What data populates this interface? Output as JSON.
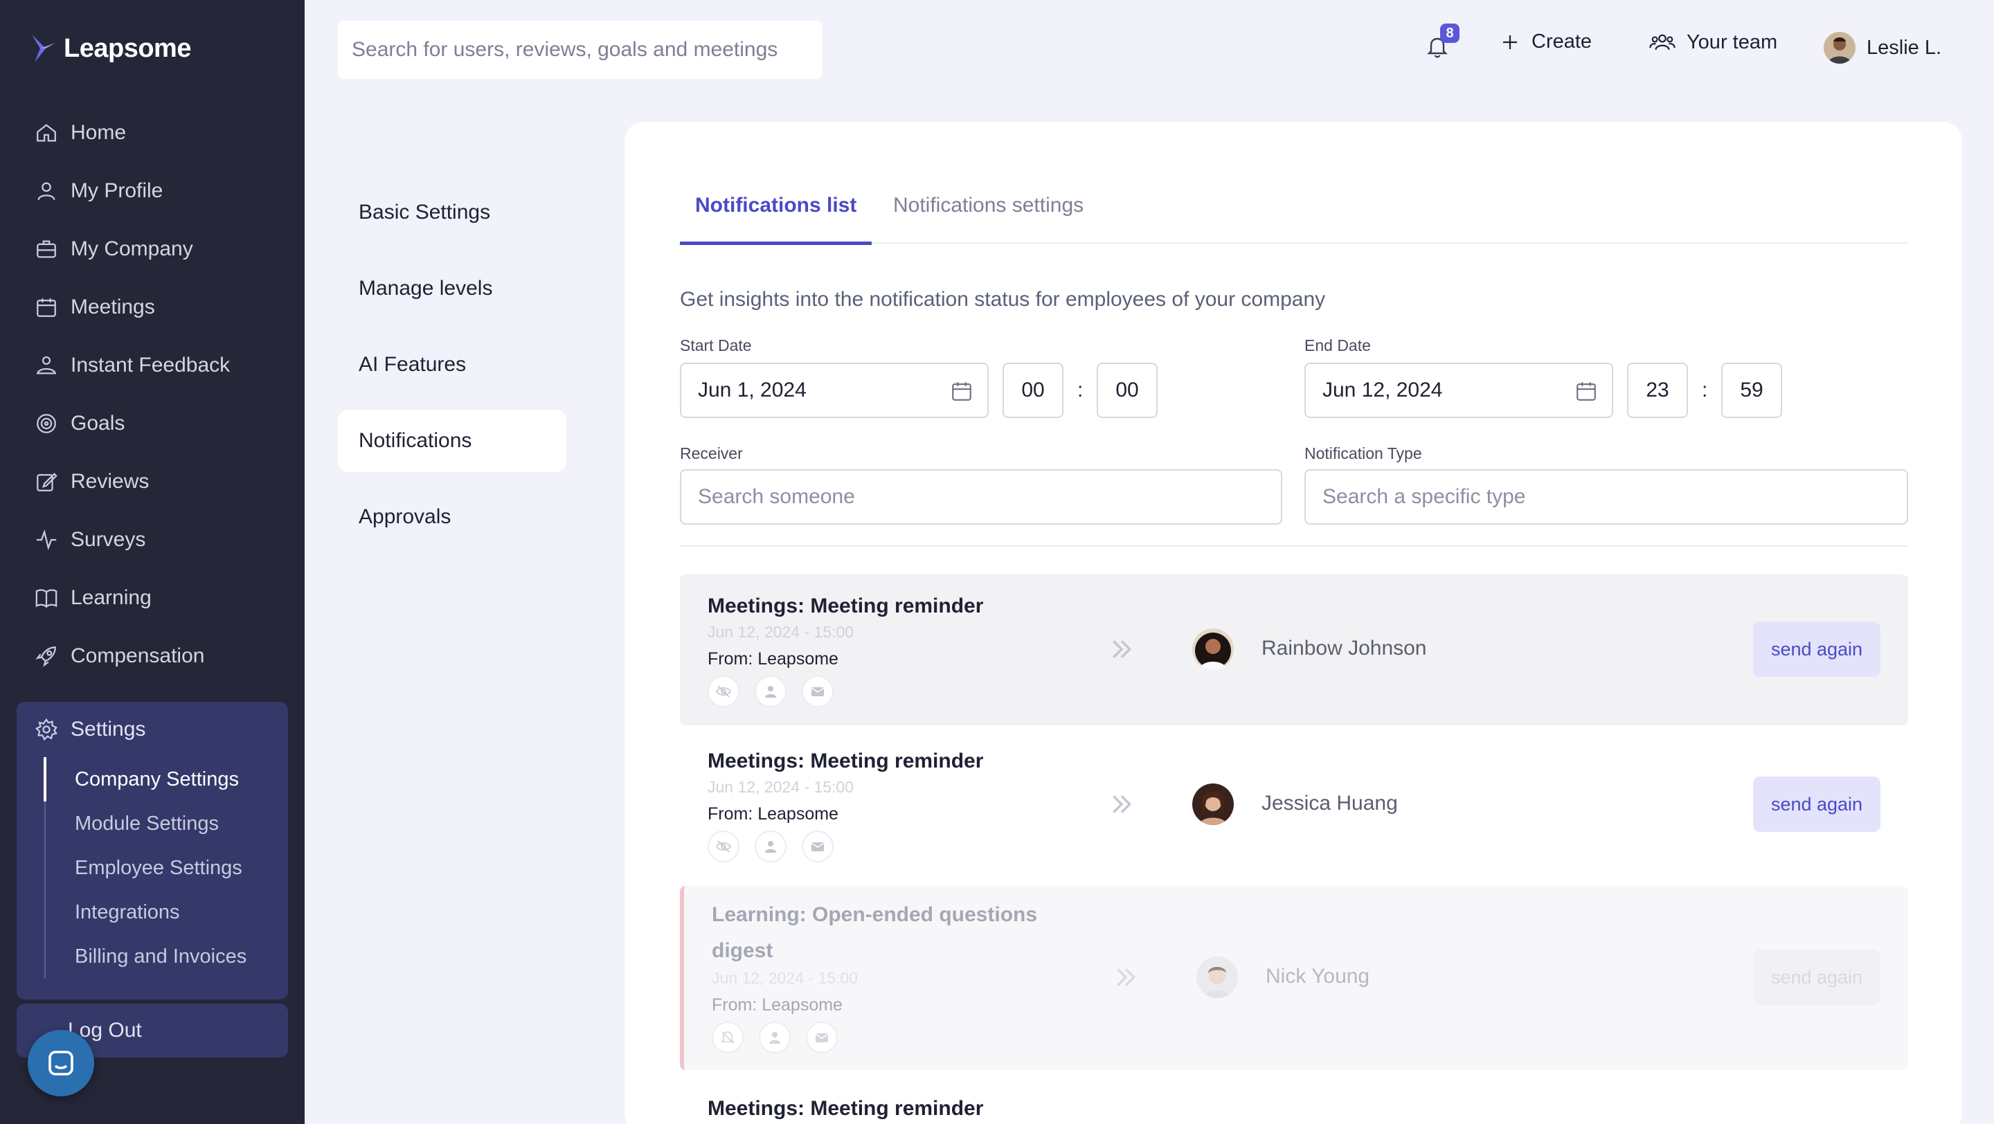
{
  "app": {
    "name": "Leapsome"
  },
  "sidebar": {
    "items": [
      {
        "label": "Home",
        "icon": "home-icon"
      },
      {
        "label": "My Profile",
        "icon": "user-icon"
      },
      {
        "label": "My Company",
        "icon": "briefcase-icon"
      },
      {
        "label": "Meetings",
        "icon": "calendar-icon"
      },
      {
        "label": "Instant Feedback",
        "icon": "feedback-icon"
      },
      {
        "label": "Goals",
        "icon": "target-icon"
      },
      {
        "label": "Reviews",
        "icon": "edit-icon"
      },
      {
        "label": "Surveys",
        "icon": "pulse-icon"
      },
      {
        "label": "Learning",
        "icon": "book-icon"
      },
      {
        "label": "Compensation",
        "icon": "rocket-icon"
      }
    ],
    "settings": {
      "label": "Settings",
      "subitems": [
        "Company Settings",
        "Module Settings",
        "Employee Settings",
        "Integrations",
        "Billing and Invoices"
      ],
      "active": "Company Settings"
    },
    "logout": "Log Out"
  },
  "header": {
    "search_placeholder": "Search for users, reviews, goals and meetings",
    "notification_count": "8",
    "create_label": "Create",
    "team_label": "Your team",
    "user_name": "Leslie L."
  },
  "settings_menu": {
    "items": [
      "Basic Settings",
      "Manage levels",
      "AI Features",
      "Notifications",
      "Approvals"
    ],
    "active": "Notifications"
  },
  "main": {
    "tabs": [
      {
        "label": "Notifications list",
        "active": true
      },
      {
        "label": "Notifications settings",
        "active": false
      }
    ],
    "description": "Get insights into the notification status for employees of your company",
    "filters": {
      "start_label": "Start Date",
      "start_date": "Jun 1, 2024",
      "start_hour": "00",
      "start_minute": "00",
      "end_label": "End Date",
      "end_date": "Jun 12, 2024",
      "end_hour": "23",
      "end_minute": "59",
      "receiver_label": "Receiver",
      "receiver_placeholder": "Search someone",
      "type_label": "Notification Type",
      "type_placeholder": "Search a specific type",
      "time_separator": ":"
    },
    "notifications": [
      {
        "title": "Meetings: Meeting reminder",
        "date": "Jun 12, 2024 - 15:00",
        "from": "From: Leapsome",
        "receiver": "Rainbow Johnson",
        "action": "send again",
        "state": "highlighted"
      },
      {
        "title": "Meetings: Meeting reminder",
        "date": "Jun 12, 2024 - 15:00",
        "from": "From: Leapsome",
        "receiver": "Jessica Huang",
        "action": "send again",
        "state": "normal"
      },
      {
        "title": "Learning: Open-ended questions digest",
        "date": "Jun 12, 2024 - 15:00",
        "from": "From: Leapsome",
        "receiver": "Nick Young",
        "action": "send again",
        "state": "disabled"
      },
      {
        "title": "Meetings: Meeting reminder"
      }
    ]
  },
  "colors": {
    "sidebar_bg": "#252638",
    "settings_bg": "#353969",
    "accent": "#4b49c5",
    "page_bg": "#f1f2fa",
    "badge": "#5a58d6"
  }
}
